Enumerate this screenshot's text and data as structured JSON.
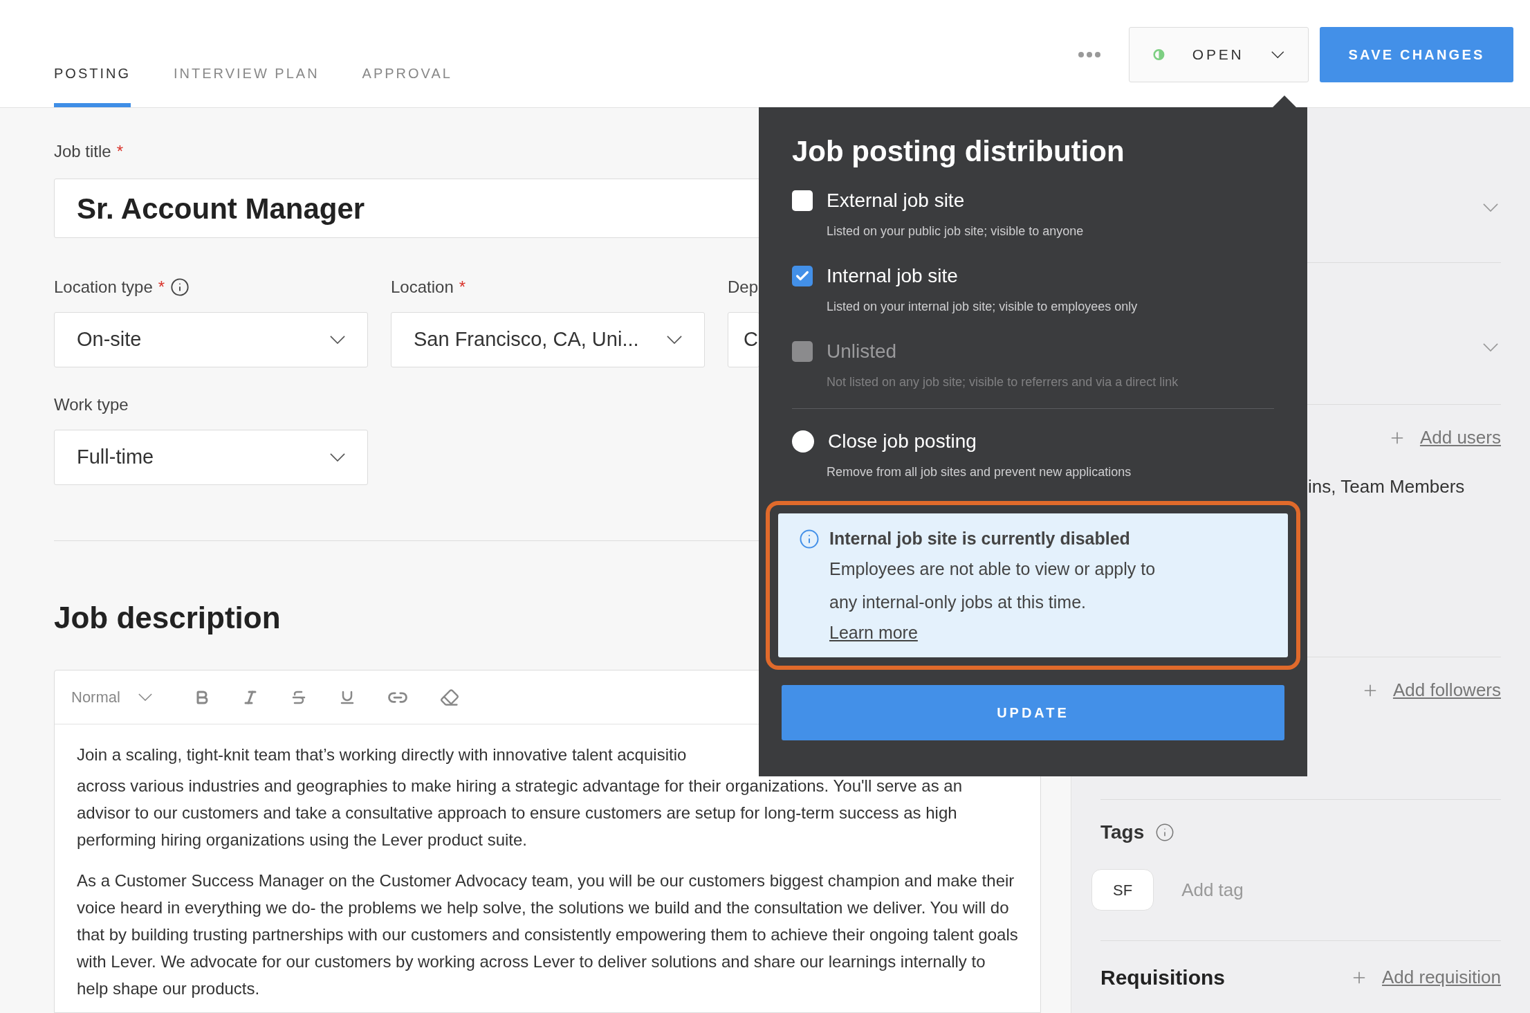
{
  "tabs": [
    {
      "label": "POSTING",
      "selected": true
    },
    {
      "label": "INTERVIEW PLAN",
      "selected": false
    },
    {
      "label": "APPROVAL",
      "selected": false
    }
  ],
  "header_actions": {
    "status": "OPEN",
    "save_button": "SAVE CHANGES"
  },
  "form": {
    "job_title": {
      "label": "Job title",
      "required_mark": "*",
      "value": "Sr. Account Manager"
    },
    "field_rows": [
      [
        {
          "label": "Location type",
          "required_mark": "*",
          "info": true,
          "value": "On-site"
        },
        {
          "label": "Location",
          "required_mark": "*",
          "info": false,
          "value": "San Francisco, CA, Uni..."
        },
        {
          "label": "Dep",
          "info": false,
          "value": "C"
        }
      ],
      [
        {
          "label": "Work type",
          "info": false,
          "value": "Full-time"
        }
      ]
    ]
  },
  "job_description": {
    "heading": "Job description",
    "toolbar": {
      "format": "Normal"
    },
    "first_line": "Join a scaling, tight-knit team that’s working directly with innovative talent acquisitio",
    "paragraphs": [
      "across various industries and geographies to make hiring a strategic advantage for their organizations. You'll serve as an advisor to our customers and take a consultative approach to ensure customers are setup for long-term success as high performing hiring organizations using the Lever product suite.",
      "As a Customer Success Manager on the Customer Advocacy team, you will be our customers biggest champion and make their voice heard in everything we do- the problems we help solve, the solutions we build and the consultation we deliver. You will do that by building trusting partnerships with our customers and consistently empowering them to achieve their ongoing talent goals with Lever. We advocate for our customers by working across Lever to deliver solutions and share our learnings internally to help shape our products."
    ]
  },
  "popover": {
    "title": "Job posting distribution",
    "options": [
      {
        "kind": "checkbox",
        "label": "External job site",
        "description": "Listed on your public job site; visible to anyone",
        "checked": false,
        "disabled": false
      },
      {
        "kind": "checkbox",
        "label": "Internal job site",
        "description": "Listed on your internal job site; visible to employees only",
        "checked": true,
        "disabled": false
      },
      {
        "kind": "checkbox",
        "label": "Unlisted",
        "description": "Not listed on any job site; visible to referrers and via a direct link",
        "checked": false,
        "disabled": true
      },
      {
        "kind": "radio",
        "label": "Close job posting",
        "description": "Remove from all job sites and prevent new applications",
        "selected": false
      }
    ],
    "alert": {
      "title": "Internal job site is currently disabled",
      "body": "Employees are not able to view or apply to any internal-only jobs at this time.",
      "link": "Learn more",
      "highlighted": true
    },
    "button": "UPDATE"
  },
  "side_panel": {
    "sections": [
      {
        "kind": "select"
      },
      {
        "kind": "select"
      },
      {
        "kind": "action",
        "action": "Add users",
        "text": "ins, Team Members"
      },
      {
        "kind": "action",
        "action": "Add followers"
      }
    ],
    "tags": {
      "title": "Tags",
      "tags": [
        "SF"
      ],
      "placeholder": "Add tag"
    },
    "requisitions": {
      "title": "Requisitions",
      "action": "Add requisition"
    }
  }
}
